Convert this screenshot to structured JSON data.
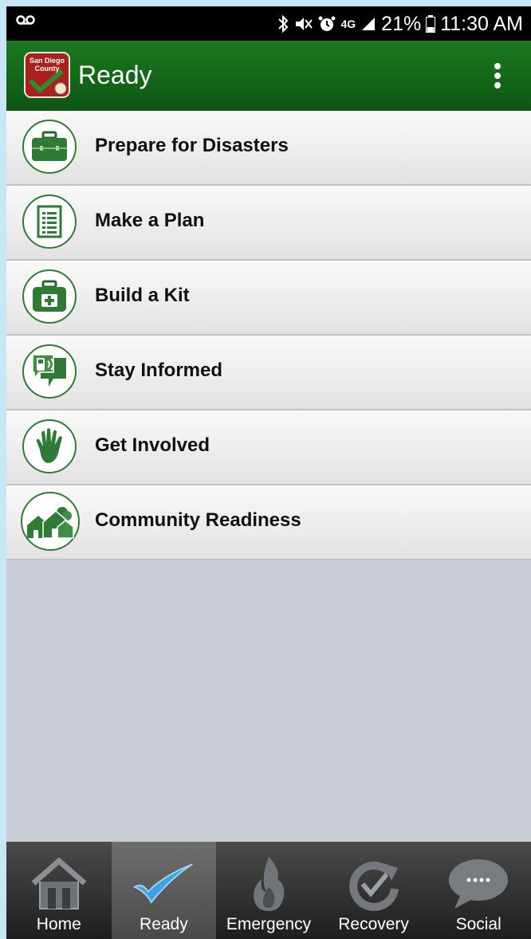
{
  "status_bar": {
    "battery_percent": "21%",
    "time": "11:30 AM",
    "network": "4G",
    "icons": [
      "voicemail-icon",
      "bluetooth-icon",
      "mute-icon",
      "alarm-icon",
      "lte-icon",
      "signal-icon",
      "battery-icon"
    ]
  },
  "app_bar": {
    "title": "Ready",
    "logo_text": "San Diego County",
    "menu_icon": "overflow-menu-icon"
  },
  "menu": {
    "items": [
      {
        "label": "Prepare for Disasters",
        "icon": "briefcase-icon"
      },
      {
        "label": "Make a Plan",
        "icon": "document-icon"
      },
      {
        "label": "Build a Kit",
        "icon": "first-aid-kit-icon"
      },
      {
        "label": "Stay Informed",
        "icon": "phone-chat-icon"
      },
      {
        "label": "Get Involved",
        "icon": "hand-icon"
      },
      {
        "label": "Community Readiness",
        "icon": "houses-icon"
      }
    ]
  },
  "tabs": [
    {
      "label": "Home",
      "icon": "home-icon",
      "active": false
    },
    {
      "label": "Ready",
      "icon": "checkmark-icon",
      "active": true
    },
    {
      "label": "Emergency",
      "icon": "flame-icon",
      "active": false
    },
    {
      "label": "Recovery",
      "icon": "recovery-icon",
      "active": false
    },
    {
      "label": "Social",
      "icon": "speech-bubble-icon",
      "active": false
    }
  ],
  "colors": {
    "app_bar_green": "#0d5613",
    "icon_green": "#2f7a34",
    "logo_red": "#a8211c",
    "tab_active_accent": "#3aa3e0"
  }
}
